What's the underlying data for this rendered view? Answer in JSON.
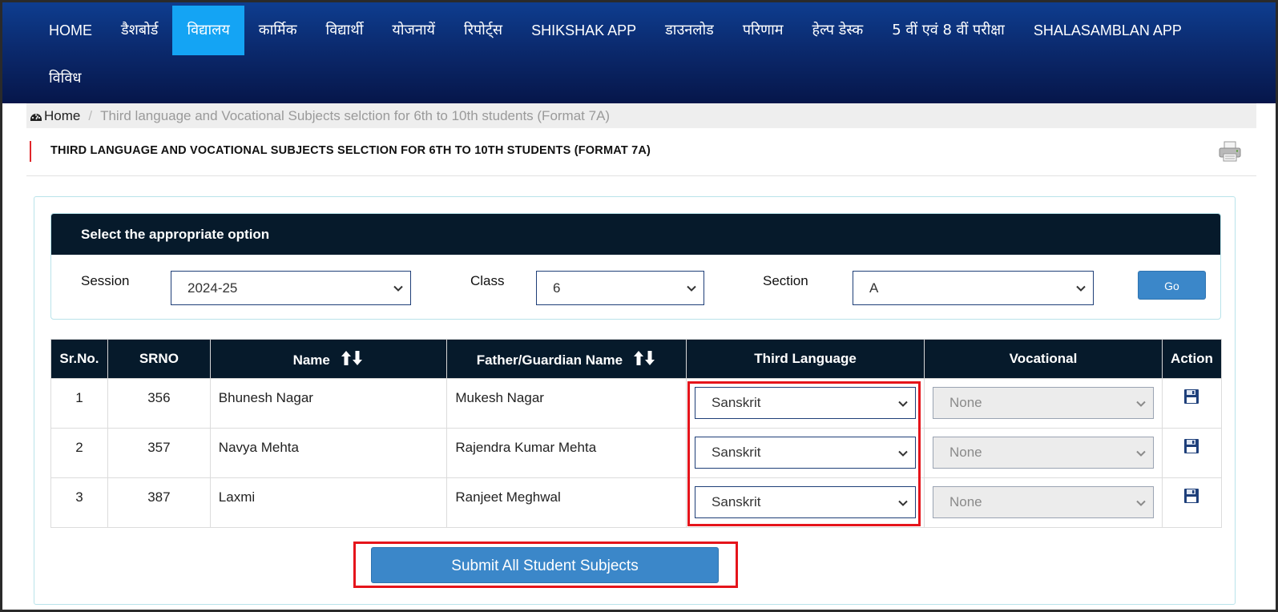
{
  "nav": {
    "row1": [
      {
        "label": "HOME",
        "active": false
      },
      {
        "label": "डैशबोर्ड",
        "active": false
      },
      {
        "label": "विद्यालय",
        "active": true
      },
      {
        "label": "कार्मिक",
        "active": false
      },
      {
        "label": "विद्यार्थी",
        "active": false
      },
      {
        "label": "योजनायें",
        "active": false
      },
      {
        "label": "रिपोर्ट्स",
        "active": false
      },
      {
        "label": "SHIKSHAK APP",
        "active": false
      },
      {
        "label": "डाउनलोड",
        "active": false
      },
      {
        "label": "परिणाम",
        "active": false
      },
      {
        "label": "हेल्प डेस्क",
        "active": false
      },
      {
        "label": "5 वीं एवं 8 वीं परीक्षा",
        "active": false
      },
      {
        "label": "SHALASAMBLAN APP",
        "active": false
      }
    ],
    "row2": [
      {
        "label": "विविध",
        "active": false
      }
    ]
  },
  "breadcrumb": {
    "home": "Home",
    "current": "Third language and Vocational Subjects selction for 6th to 10th students (Format 7A)"
  },
  "page": {
    "title": "THIRD LANGUAGE AND VOCATIONAL SUBJECTS SELCTION FOR 6TH TO 10TH STUDENTS (FORMAT 7A)"
  },
  "filters": {
    "header": "Select the appropriate option",
    "session_label": "Session",
    "session_value": "2024-25",
    "class_label": "Class",
    "class_value": "6",
    "section_label": "Section",
    "section_value": "A",
    "go_label": "Go"
  },
  "table": {
    "headers": {
      "srno": "Sr.No.",
      "srno2": "SRNO",
      "name": "Name",
      "father": "Father/Guardian Name",
      "third": "Third Language",
      "vocational": "Vocational",
      "action": "Action"
    },
    "rows": [
      {
        "sr": "1",
        "srno": "356",
        "name": "Bhunesh Nagar",
        "father": "Mukesh Nagar",
        "third": "Sanskrit",
        "vocational": "None"
      },
      {
        "sr": "2",
        "srno": "357",
        "name": "Navya Mehta",
        "father": "Rajendra Kumar Mehta",
        "third": "Sanskrit",
        "vocational": "None"
      },
      {
        "sr": "3",
        "srno": "387",
        "name": "Laxmi",
        "father": "Ranjeet Meghwal",
        "third": "Sanskrit",
        "vocational": "None"
      }
    ]
  },
  "submit_label": "Submit All Student Subjects",
  "colors": {
    "nav_active": "#14a4f4",
    "header_dark": "#061a2b",
    "button_blue": "#3b87c9",
    "highlight_red": "#e5141b"
  }
}
